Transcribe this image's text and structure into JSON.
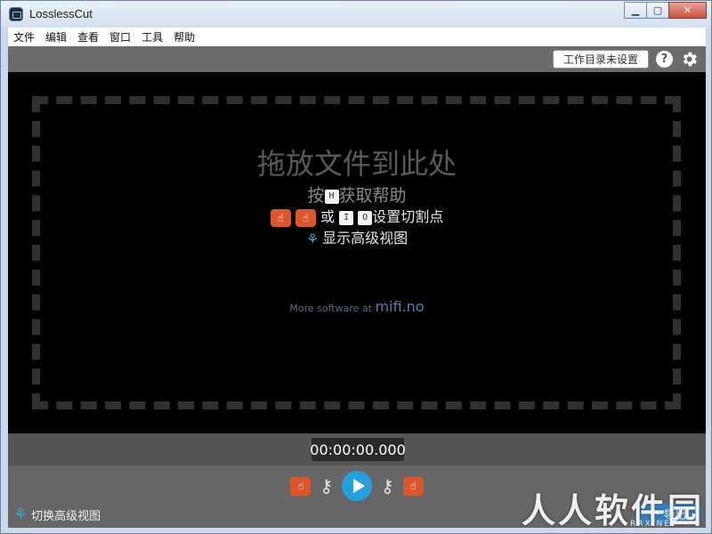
{
  "window": {
    "title": "LosslessCut"
  },
  "menu": [
    "文件",
    "编辑",
    "查看",
    "窗口",
    "工具",
    "帮助"
  ],
  "topbar": {
    "workdir_label": "工作目录未设置",
    "help_label": "?"
  },
  "dropzone": {
    "title": "拖放文件到此处",
    "help_prefix": "按",
    "help_key": "H",
    "help_suffix": "获取帮助",
    "cut_or": "或",
    "key_i": "I",
    "key_o": "O",
    "cut_suffix": "设置切割点",
    "advanced_view": "显示高级视图",
    "more_software": "More software at",
    "more_link": "mifi.no"
  },
  "timeline": {
    "timecode": "00:00:00.000"
  },
  "controls": {
    "toggle_advanced": "切换高级视图",
    "export_label": "导出"
  },
  "watermark": {
    "text": "人人软件园",
    "sub": "RRX.NET"
  },
  "colors": {
    "accent_blue": "#26a0da",
    "cut_orange": "#d8572b"
  }
}
